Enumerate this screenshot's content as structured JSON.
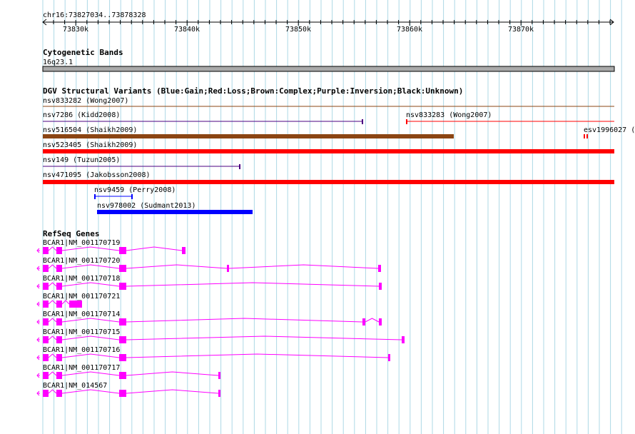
{
  "region": {
    "label": "chr16:73827034..73878328",
    "ticks": [
      "73830k",
      "73840k",
      "73850k",
      "73860k",
      "73870k"
    ]
  },
  "tracks": {
    "cytoband": {
      "title": "Cytogenetic Bands",
      "band": "16q23.1"
    },
    "dgv": {
      "title": "DGV Structural Variants (Blue:Gain;Red:Loss;Brown:Complex;Purple:Inversion;Black:Unknown)",
      "variants": [
        {
          "label": "nsv833282 (Wong2007)",
          "type": "thin",
          "color": "#8b4513"
        },
        {
          "label": "nsv7286 (Kidd2008)",
          "type": "thin",
          "color": "#4b0082"
        },
        {
          "label": "nsv833283 (Wong2007)",
          "type": "thin",
          "color": "#ff0000"
        },
        {
          "label": "nsv516504 (Shaikh2009)",
          "type": "thick",
          "color": "#8b4513"
        },
        {
          "label": "esv1996027 (",
          "type": "marks",
          "color": "#ff0000"
        },
        {
          "label": "nsv523405 (Shaikh2009)",
          "type": "thick",
          "color": "#ff0000"
        },
        {
          "label": "nsv149 (Tuzun2005)",
          "type": "thin",
          "color": "#4b0082"
        },
        {
          "label": "nsv471095 (Jakobsson2008)",
          "type": "thick",
          "color": "#ff0000"
        },
        {
          "label": "nsv9459 (Perry2008)",
          "type": "thin",
          "color": "#0000ff"
        },
        {
          "label": "nsv978002 (Sudmant2013)",
          "type": "thick",
          "color": "#0000ff"
        }
      ]
    },
    "refseq": {
      "title": "RefSeq Genes",
      "gene_color": "#ff00ff",
      "transcripts": [
        {
          "label": "BCAR1|NM_001170719"
        },
        {
          "label": "BCAR1|NM_001170720"
        },
        {
          "label": "BCAR1|NM_001170718"
        },
        {
          "label": "BCAR1|NM_001170721"
        },
        {
          "label": "BCAR1|NM_001170714"
        },
        {
          "label": "BCAR1|NM_001170715"
        },
        {
          "label": "BCAR1|NM_001170716"
        },
        {
          "label": "BCAR1|NM_001170717"
        },
        {
          "label": "BCAR1|NM_014567"
        }
      ]
    }
  },
  "colors": {
    "grid": "#add8e6",
    "cytoband": "#a9a9a9",
    "axis": "#000000"
  }
}
